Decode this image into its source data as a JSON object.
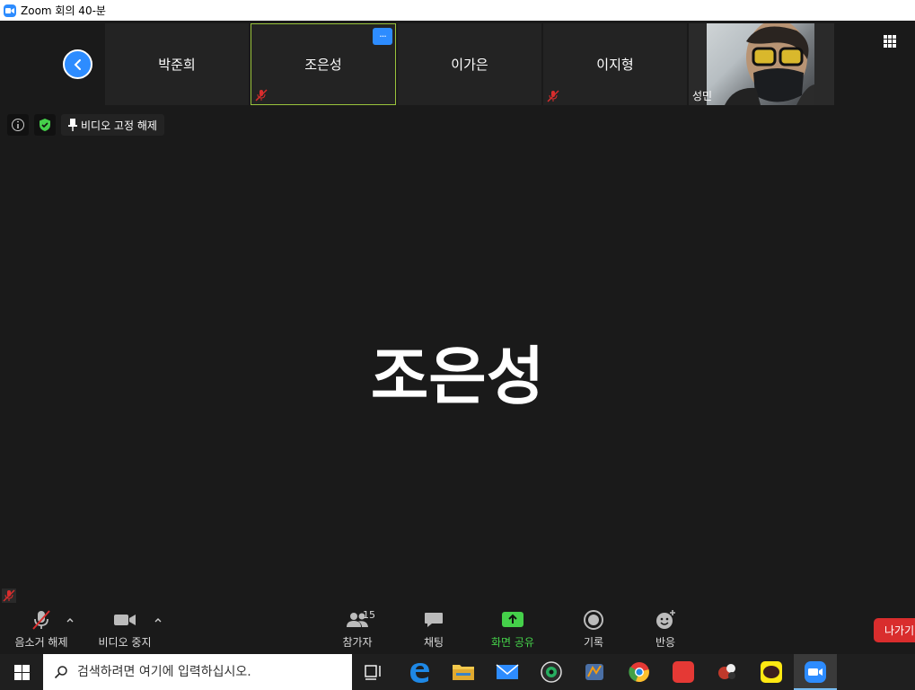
{
  "window": {
    "title": "Zoom 회의 40-분"
  },
  "thumbnails": [
    {
      "name": "박준희",
      "muted": false
    },
    {
      "name": "조은성",
      "muted": true,
      "active": true
    },
    {
      "name": "이가은",
      "muted": false
    },
    {
      "name": "이지형",
      "muted": true
    },
    {
      "name": "성민",
      "video": true
    }
  ],
  "thumb_more_label": "···",
  "info_bar": {
    "info_icon": "info-icon",
    "security_icon": "shield-icon",
    "unpin_label": "비디오 고정 해제"
  },
  "speaker": {
    "name": "조은성"
  },
  "toolbar": {
    "mute_label": "음소거 해제",
    "video_label": "비디오 중지",
    "participants_label": "참가자",
    "participants_count": "15",
    "chat_label": "채팅",
    "share_label": "화면 공유",
    "record_label": "기록",
    "reactions_label": "반응",
    "leave_label": "나가기"
  },
  "taskbar": {
    "search_placeholder": "검색하려면 여기에 입력하십시오.",
    "apps": [
      "task-view",
      "edge",
      "file-explorer",
      "mail",
      "camera",
      "app-extra",
      "chrome",
      "app-red",
      "app-bowling",
      "kakaotalk",
      "zoom"
    ]
  },
  "colors": {
    "zoom_blue": "#2d8cff",
    "share_green": "#45d04a",
    "leave_red": "#d92d2d",
    "active_border": "#9ac33c",
    "mute_red": "#d92d2d"
  }
}
